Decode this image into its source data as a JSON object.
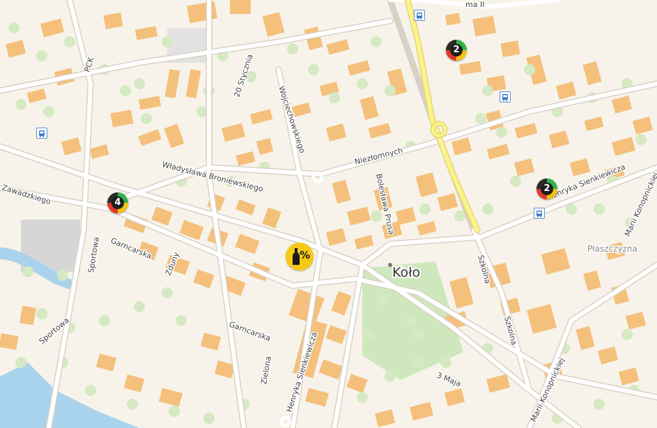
{
  "map": {
    "city_label": "Koło",
    "district_label": "Płaszczyzna",
    "streets": {
      "jana_ii": "ma II",
      "pck": "PCK",
      "dwudziestego_stycznia": "20 Stycznia",
      "wojciechowskiego": "Wojciechowskiego",
      "niezlomnych": "Niezłomnych",
      "broniewskiego": "Władysława Broniewskiego",
      "zawadzkiego": "Zawadzkiego",
      "sportowa_1": "Sportowa",
      "sportowa_2": "Sportowa",
      "garncarska_1": "Garncarska",
      "garncarska_2": "Garncarska",
      "zduny": "Zduny",
      "boleslawa_prusa": "Bolesława Prusa",
      "sienkiewicza_1": "Henryka Sienkiewicza",
      "sienkiewicza_2": "Henryka Sienkiewicza",
      "szkolna_1": "Szkolna",
      "szkolna_2": "Szkolna",
      "konopnickiej_1": "Marii Konopnickiej",
      "konopnickiej_2": "Marii Konopnickiej",
      "zielona": "Zielona",
      "trzeciego_maja": "3 Maja"
    },
    "markers": [
      {
        "id": "m1",
        "count": "2"
      },
      {
        "id": "m2",
        "count": "4"
      },
      {
        "id": "m3",
        "count": "2"
      }
    ],
    "promo_marker": {
      "label": "%",
      "icon": "bottle-icon"
    },
    "bus_stop_icon": "bus-icon",
    "colors": {
      "background": "#f7f3ea",
      "building": "#f4c07c",
      "tree": "#d5e9c3",
      "park": "#cfe7bd",
      "water": "#a9d3ec",
      "road": "#ffffff",
      "main_road": "#fdf38b",
      "marker_green": "#34b24a",
      "marker_yellow": "#f4c20d",
      "marker_red": "#e5362a",
      "promo": "#f6c915"
    }
  }
}
